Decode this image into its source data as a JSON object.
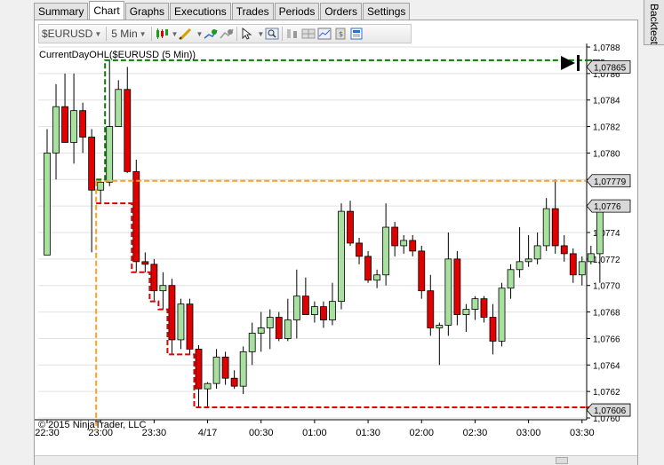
{
  "tabs": [
    {
      "label": "Summary",
      "active": false
    },
    {
      "label": "Chart",
      "active": true
    },
    {
      "label": "Graphs",
      "active": false
    },
    {
      "label": "Executions",
      "active": false
    },
    {
      "label": "Trades",
      "active": false
    },
    {
      "label": "Periods",
      "active": false
    },
    {
      "label": "Orders",
      "active": false
    },
    {
      "label": "Settings",
      "active": false
    }
  ],
  "side_tab": {
    "label": "Backtest"
  },
  "toolbar": {
    "instrument": "$EURUSD",
    "interval": "5 Min",
    "icons": [
      "instrument-dropdown",
      "interval-dropdown",
      "chart-style-icon",
      "drawing-tool-icon",
      "add-indicator-icon",
      "add-strategy-icon",
      "cursor-icon",
      "zoom-icon",
      "properties-icon",
      "data-box-icon",
      "display-icon",
      "calculator-icon",
      "layout-icon"
    ]
  },
  "chart": {
    "indicator_label": "CurrentDayOHL($EURUSD (5 Min))",
    "copyright": "© 2015 NinjaTrader, LLC",
    "price_ticks": [
      "1,0788",
      "1,0786",
      "1,0784",
      "1,0782",
      "1,0780",
      "1,0778",
      "1,0776",
      "1,0774",
      "1,0772",
      "1,0770",
      "1,0768",
      "1,0766",
      "1,0764",
      "1,0762",
      "1,0760"
    ],
    "time_ticks": [
      "22:30",
      "23:00",
      "23:30",
      "4/17",
      "00:30",
      "01:00",
      "01:30",
      "02:00",
      "02:30",
      "03:00",
      "03:30"
    ],
    "high_label": "1,07865",
    "open_label": "1,07779",
    "last_label": "1,0776",
    "low_label": "1,07606",
    "colors": {
      "up": "#a8e0a0",
      "down": "#e00000",
      "high": "#008000",
      "open": "#ffa020",
      "low": "#e00000",
      "grid": "#e0e0e0",
      "text": "#000000"
    }
  },
  "chart_data": {
    "type": "candlestick",
    "x_range": [
      "22:30",
      "03:30"
    ],
    "ylim": [
      1.076,
      1.0788
    ],
    "high_line": 1.07865,
    "open_line": 1.07779,
    "low_line": 1.07606,
    "last": 1.0776,
    "candles": [
      [
        1.07723,
        1.07818,
        1.07723,
        1.078
      ],
      [
        1.078,
        1.07852,
        1.0778,
        1.07835
      ],
      [
        1.07835,
        1.0786,
        1.07808,
        1.07808
      ],
      [
        1.07808,
        1.0786,
        1.07792,
        1.07832
      ],
      [
        1.07832,
        1.07838,
        1.078,
        1.07812
      ],
      [
        1.07812,
        1.07818,
        1.07725,
        1.07772
      ],
      [
        1.07772,
        1.0778,
        1.07762,
        1.07778
      ],
      [
        1.07778,
        1.0787,
        1.07775,
        1.0782
      ],
      [
        1.0782,
        1.07855,
        1.0782,
        1.07848
      ],
      [
        1.07848,
        1.07865,
        1.07785,
        1.07786
      ],
      [
        1.07786,
        1.07795,
        1.0771,
        1.07718
      ],
      [
        1.07718,
        1.07725,
        1.0771,
        1.07716
      ],
      [
        1.07716,
        1.0772,
        1.07688,
        1.07696
      ],
      [
        1.07696,
        1.0771,
        1.07682,
        1.077
      ],
      [
        1.077,
        1.07705,
        1.07648,
        1.07659
      ],
      [
        1.07659,
        1.0769,
        1.07652,
        1.07686
      ],
      [
        1.07686,
        1.0769,
        1.07648,
        1.07652
      ],
      [
        1.07652,
        1.07655,
        1.07608,
        1.07622
      ],
      [
        1.07622,
        1.07627,
        1.07608,
        1.07626
      ],
      [
        1.07626,
        1.07652,
        1.07622,
        1.07646
      ],
      [
        1.07646,
        1.0765,
        1.07625,
        1.0763
      ],
      [
        1.0763,
        1.07636,
        1.07622,
        1.07624
      ],
      [
        1.07624,
        1.07654,
        1.07618,
        1.0765
      ],
      [
        1.0765,
        1.07672,
        1.0764,
        1.07664
      ],
      [
        1.07664,
        1.0768,
        1.0765,
        1.07668
      ],
      [
        1.07668,
        1.07682,
        1.07652,
        1.07676
      ],
      [
        1.07676,
        1.0768,
        1.07658,
        1.0766
      ],
      [
        1.0766,
        1.0769,
        1.07658,
        1.07674
      ],
      [
        1.07674,
        1.07712,
        1.0766,
        1.07692
      ],
      [
        1.07692,
        1.07706,
        1.0768,
        1.07678
      ],
      [
        1.07678,
        1.07688,
        1.07672,
        1.07684
      ],
      [
        1.07684,
        1.07688,
        1.07668,
        1.07674
      ],
      [
        1.07674,
        1.07702,
        1.0767,
        1.07688
      ],
      [
        1.07688,
        1.07762,
        1.07682,
        1.07756
      ],
      [
        1.07756,
        1.07764,
        1.0773,
        1.07732
      ],
      [
        1.07732,
        1.07736,
        1.07716,
        1.07722
      ],
      [
        1.07722,
        1.07726,
        1.07702,
        1.07704
      ],
      [
        1.07704,
        1.07712,
        1.07698,
        1.07708
      ],
      [
        1.07708,
        1.07762,
        1.077,
        1.07744
      ],
      [
        1.07744,
        1.07748,
        1.07722,
        1.0773
      ],
      [
        1.0773,
        1.07738,
        1.07724,
        1.07734
      ],
      [
        1.07734,
        1.07738,
        1.07722,
        1.07726
      ],
      [
        1.07726,
        1.0773,
        1.0769,
        1.07696
      ],
      [
        1.07696,
        1.07708,
        1.07662,
        1.07668
      ],
      [
        1.07668,
        1.07672,
        1.0764,
        1.0767
      ],
      [
        1.0767,
        1.0774,
        1.07662,
        1.0772
      ],
      [
        1.0772,
        1.07726,
        1.0767,
        1.07678
      ],
      [
        1.07678,
        1.07686,
        1.07665,
        1.07682
      ],
      [
        1.07682,
        1.07692,
        1.07674,
        1.0769
      ],
      [
        1.0769,
        1.07692,
        1.07672,
        1.07676
      ],
      [
        1.07676,
        1.07686,
        1.07648,
        1.07658
      ],
      [
        1.07658,
        1.07702,
        1.07654,
        1.07698
      ],
      [
        1.07698,
        1.07716,
        1.0769,
        1.07712
      ],
      [
        1.07712,
        1.07744,
        1.07706,
        1.07718
      ],
      [
        1.07718,
        1.07738,
        1.07714,
        1.0772
      ],
      [
        1.0772,
        1.0774,
        1.07716,
        1.0773
      ],
      [
        1.0773,
        1.07766,
        1.07726,
        1.07758
      ],
      [
        1.07758,
        1.0778,
        1.07724,
        1.0773
      ],
      [
        1.0773,
        1.07738,
        1.07718,
        1.07724
      ],
      [
        1.07724,
        1.07728,
        1.07702,
        1.07708
      ],
      [
        1.07708,
        1.07722,
        1.077,
        1.07718
      ],
      [
        1.07718,
        1.0773,
        1.07716,
        1.07724
      ],
      [
        1.07724,
        1.07742,
        1.07702,
        1.0776
      ]
    ]
  }
}
